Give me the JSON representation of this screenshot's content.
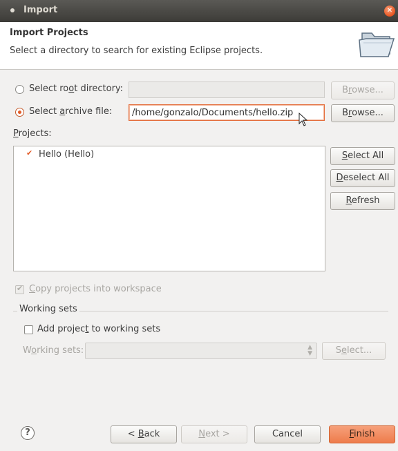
{
  "window": {
    "title": "Import"
  },
  "header": {
    "title": "Import Projects",
    "description": "Select a directory to search for existing Eclipse projects."
  },
  "source": {
    "root_radio": {
      "pre": "Select ro",
      "mn": "o",
      "post": "t directory:"
    },
    "root_field_value": "",
    "root_browse": {
      "pre": "B",
      "mn": "r",
      "post": "owse..."
    },
    "archive_radio": {
      "pre": "Select ",
      "mn": "a",
      "post": "rchive file:"
    },
    "archive_field_value": "/home/gonzalo/Documents/hello.zip",
    "archive_browse": {
      "pre": "B",
      "mn": "r",
      "post": "owse..."
    }
  },
  "projects": {
    "label": {
      "pre": "",
      "mn": "P",
      "post": "rojects:"
    },
    "items": [
      {
        "label": "Hello (Hello)",
        "checked": true
      }
    ],
    "select_all": {
      "pre": "",
      "mn": "S",
      "post": "elect All"
    },
    "deselect_all": {
      "pre": "",
      "mn": "D",
      "post": "eselect All"
    },
    "refresh": {
      "pre": "",
      "mn": "R",
      "post": "efresh"
    }
  },
  "copy_option": {
    "pre": "",
    "mn": "C",
    "post": "opy projects into workspace"
  },
  "working_sets": {
    "legend": "Working sets",
    "add_checkbox": {
      "pre": "Add projec",
      "mn": "t",
      "post": " to working sets"
    },
    "label": {
      "pre": "W",
      "mn": "o",
      "post": "rking sets:"
    },
    "combo_value": "",
    "select_button": {
      "pre": "S",
      "mn": "e",
      "post": "lect..."
    }
  },
  "footer": {
    "help": "?",
    "back": {
      "pre": "< ",
      "mn": "B",
      "post": "ack"
    },
    "next": {
      "pre": "",
      "mn": "N",
      "post": "ext >"
    },
    "cancel": "Cancel",
    "finish": {
      "pre": "",
      "mn": "F",
      "post": "inish"
    }
  },
  "colors": {
    "accent": "#e25a26",
    "titlebar": "#3c3b37",
    "finish": "#ee7c4c"
  },
  "icons": [
    "window-menu-icon",
    "close-icon",
    "folder-icon",
    "help-icon",
    "mouse-cursor-icon"
  ]
}
